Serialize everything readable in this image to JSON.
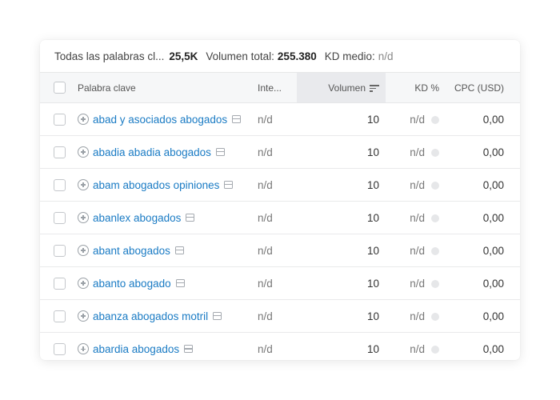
{
  "summary": {
    "all_keywords_label": "Todas las palabras cl...",
    "all_keywords_value": "25,5K",
    "total_volume_label": "Volumen total:",
    "total_volume_value": "255.380",
    "kd_label": "KD medio:",
    "kd_value": "n/d"
  },
  "columns": {
    "keyword": "Palabra clave",
    "intent": "Inte...",
    "volume": "Volumen",
    "kd": "KD %",
    "cpc": "CPC (USD)"
  },
  "rows": [
    {
      "keyword": "abad y asociados abogados",
      "intent": "n/d",
      "volume": "10",
      "kd": "n/d",
      "cpc": "0,00"
    },
    {
      "keyword": "abadia abadia abogados",
      "intent": "n/d",
      "volume": "10",
      "kd": "n/d",
      "cpc": "0,00"
    },
    {
      "keyword": "abam abogados opiniones",
      "intent": "n/d",
      "volume": "10",
      "kd": "n/d",
      "cpc": "0,00"
    },
    {
      "keyword": "abanlex abogados",
      "intent": "n/d",
      "volume": "10",
      "kd": "n/d",
      "cpc": "0,00"
    },
    {
      "keyword": "abant abogados",
      "intent": "n/d",
      "volume": "10",
      "kd": "n/d",
      "cpc": "0,00"
    },
    {
      "keyword": "abanto abogado",
      "intent": "n/d",
      "volume": "10",
      "kd": "n/d",
      "cpc": "0,00"
    },
    {
      "keyword": "abanza abogados motril",
      "intent": "n/d",
      "volume": "10",
      "kd": "n/d",
      "cpc": "0,00"
    },
    {
      "keyword": "abardia abogados",
      "intent": "n/d",
      "volume": "10",
      "kd": "n/d",
      "cpc": "0,00"
    }
  ],
  "icons": {
    "add": "plus-circle-icon",
    "serp": "serp-features-icon",
    "sort": "sort-descending-icon",
    "kd": "kd-dot-icon"
  },
  "colors": {
    "link": "#1a7bc4",
    "header_bg": "#f6f7f8",
    "sorted_header_bg": "#e9eaed"
  }
}
